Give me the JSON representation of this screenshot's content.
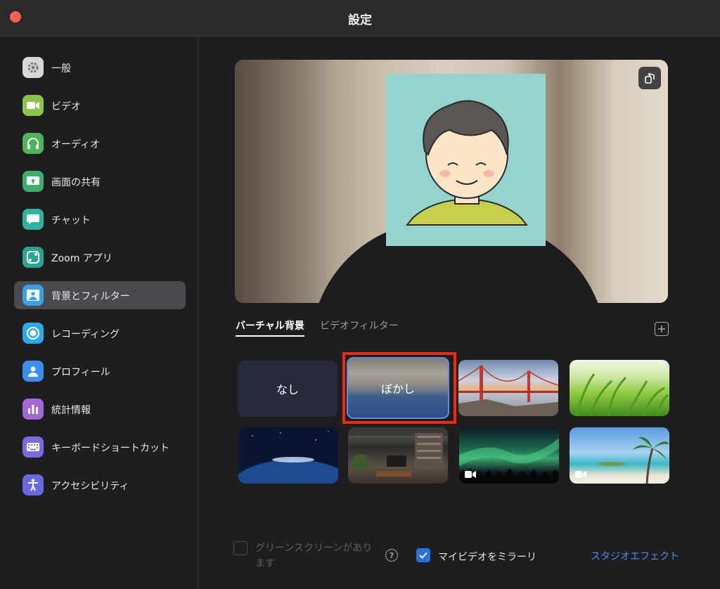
{
  "window": {
    "title": "設定"
  },
  "colors": {
    "accent": "#2a6fde",
    "selection": "#ee2a14",
    "link": "#4e8ff0",
    "close": "#ff5f57"
  },
  "sidebar": {
    "items": [
      {
        "label": "一般",
        "icon": "gear-icon",
        "color": "#d7d7d9",
        "active": false
      },
      {
        "label": "ビデオ",
        "icon": "video-camera-icon",
        "color": "#8ac449",
        "active": false
      },
      {
        "label": "オーディオ",
        "icon": "headphones-icon",
        "color": "#4fb35c",
        "active": false
      },
      {
        "label": "画面の共有",
        "icon": "share-screen-icon",
        "color": "#3fad6e",
        "active": false
      },
      {
        "label": "チャット",
        "icon": "chat-bubble-icon",
        "color": "#2fb3a0",
        "active": false
      },
      {
        "label": "Zoom アプリ",
        "icon": "apps-icon",
        "color": "#2aa592",
        "active": false
      },
      {
        "label": "背景とフィルター",
        "icon": "background-icon",
        "color": "#3aa0e8",
        "active": true
      },
      {
        "label": "レコーディング",
        "icon": "record-icon",
        "color": "#2fa8e6",
        "active": false
      },
      {
        "label": "プロフィール",
        "icon": "person-icon",
        "color": "#3b8ff0",
        "active": false
      },
      {
        "label": "統計情報",
        "icon": "bar-chart-icon",
        "color": "#a567d6",
        "active": false
      },
      {
        "label": "キーボードショートカット",
        "icon": "keyboard-icon",
        "color": "#7a6be0",
        "active": false
      },
      {
        "label": "アクセシビリティ",
        "icon": "accessibility-icon",
        "color": "#6a68e0",
        "active": false
      }
    ]
  },
  "main": {
    "tabs": [
      {
        "label": "バーチャル背景",
        "active": true
      },
      {
        "label": "ビデオフィルター",
        "active": false
      }
    ],
    "backgrounds": [
      {
        "label": "なし",
        "selected": false
      },
      {
        "label": "ぼかし",
        "selected": true
      },
      {
        "label": "",
        "image": "golden-gate-bridge",
        "selected": false
      },
      {
        "label": "",
        "image": "grass",
        "selected": false
      },
      {
        "label": "",
        "image": "earth-from-space",
        "selected": false
      },
      {
        "label": "",
        "image": "loft-room",
        "selected": false
      },
      {
        "label": "",
        "image": "aurora-video",
        "selected": false
      },
      {
        "label": "",
        "image": "beach-palm-video",
        "selected": false
      }
    ],
    "options": {
      "green_screen_label": "グリーンスクリーンがあります",
      "green_screen_checked": false,
      "mirror_label": "マイビデオをミラーリ",
      "mirror_checked": true,
      "studio_effects_label": "スタジオエフェクト"
    }
  }
}
